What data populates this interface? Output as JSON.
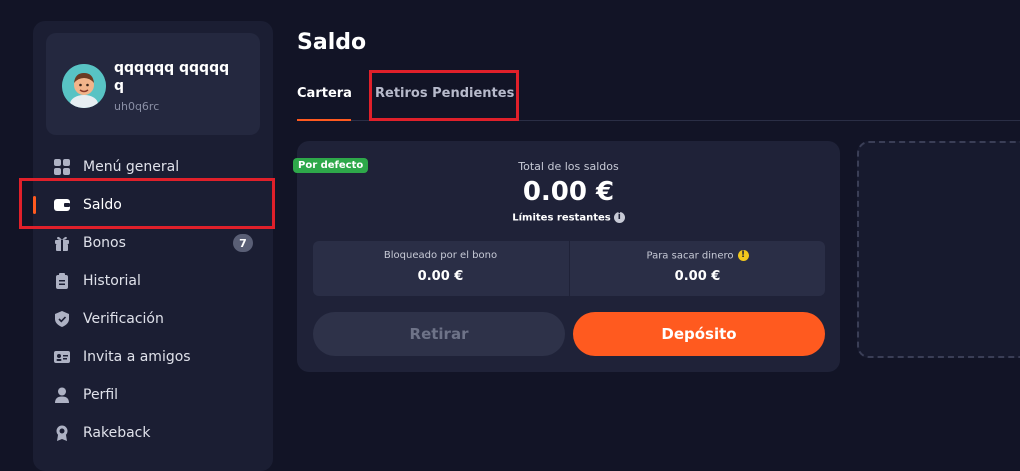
{
  "user": {
    "name": "qqqqqq qqqqqq",
    "id": "uh0q6rc"
  },
  "menu": [
    {
      "label": "Menú general",
      "icon": "grid-icon"
    },
    {
      "label": "Saldo",
      "icon": "wallet-icon",
      "active": true
    },
    {
      "label": "Bonos",
      "icon": "gift-icon",
      "badge": "7"
    },
    {
      "label": "Historial",
      "icon": "clipboard-icon"
    },
    {
      "label": "Verificación",
      "icon": "shield-icon"
    },
    {
      "label": "Invita a amigos",
      "icon": "id-card-icon"
    },
    {
      "label": "Perfil",
      "icon": "person-icon"
    },
    {
      "label": "Rakeback",
      "icon": "medal-icon"
    }
  ],
  "page": {
    "title": "Saldo"
  },
  "tabs": [
    {
      "label": "Cartera",
      "active": true
    },
    {
      "label": "Retiros Pendientes",
      "active": false
    }
  ],
  "balance": {
    "default_badge": "Por defecto",
    "total_label": "Total de los saldos",
    "total_amount": "0.00 €",
    "limits_label": "Límites restantes",
    "blocked_label": "Bloqueado por el bono",
    "blocked_value": "0.00 €",
    "withdrawable_label": "Para sacar dinero",
    "withdrawable_value": "0.00 €",
    "withdraw_button": "Retirar",
    "deposit_button": "Depósito"
  },
  "colors": {
    "accent": "#ff5a1f",
    "background": "#121426",
    "card": "#1f2238",
    "highlight": "#e0202a",
    "default_badge": "#2ea84a"
  }
}
